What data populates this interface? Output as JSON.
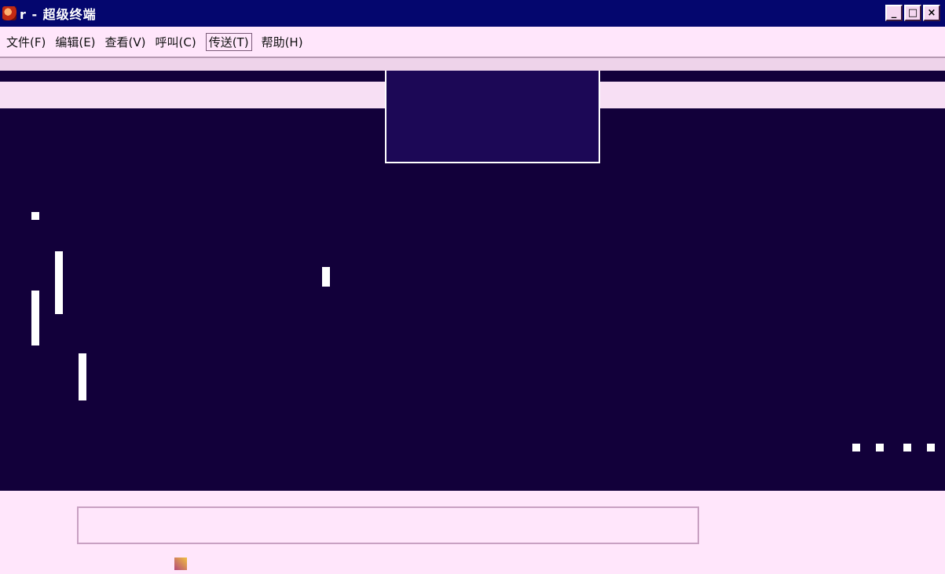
{
  "window": {
    "title": "r - 超级终端",
    "controls": {
      "minimize": "_",
      "maximize": "□",
      "close": "×"
    }
  },
  "menubar": {
    "items": [
      {
        "id": "file",
        "label": "文件(F)"
      },
      {
        "id": "edit",
        "label": "编辑(E)"
      },
      {
        "id": "view",
        "label": "查看(V)"
      },
      {
        "id": "call",
        "label": "呼叫(C)"
      },
      {
        "id": "transfer",
        "label": "传送(T)"
      },
      {
        "id": "help",
        "label": "帮助(H)"
      }
    ]
  },
  "colors": {
    "terminal_background": "#12003a",
    "title_bar": "#04066e",
    "chrome": "#ffe6fb"
  },
  "icons": {
    "app": "hyperterminal-icon",
    "status": "status-indicator-icon"
  }
}
